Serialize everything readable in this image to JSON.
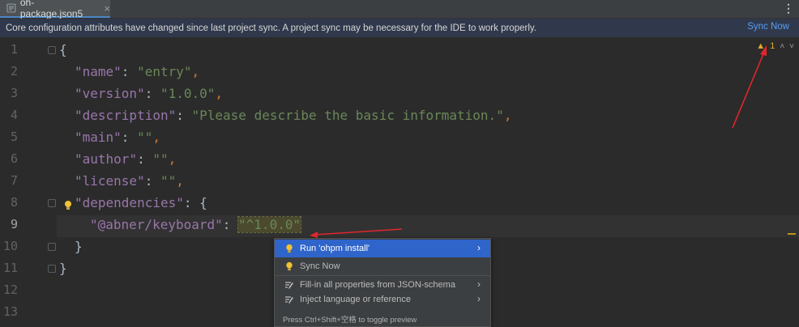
{
  "tab": {
    "filename": "oh-package.json5",
    "close": "×"
  },
  "menu_glyph": "⋮",
  "banner": {
    "message": "Core configuration attributes have changed since last project sync. A project sync may be necessary for the IDE to work properly.",
    "action": "Sync Now"
  },
  "line_numbers": [
    "1",
    "2",
    "3",
    "4",
    "5",
    "6",
    "7",
    "8",
    "9",
    "10",
    "11",
    "12",
    "13"
  ],
  "active_line": "9",
  "code": {
    "l1_brace": "{",
    "l2": {
      "key": "\"name\"",
      "colon": ": ",
      "value": "\"entry\"",
      "comma": ","
    },
    "l3": {
      "key": "\"version\"",
      "colon": ": ",
      "value": "\"1.0.0\"",
      "comma": ","
    },
    "l4": {
      "key": "\"description\"",
      "colon": ": ",
      "value": "\"Please describe the basic information.\"",
      "comma": ","
    },
    "l5": {
      "key": "\"main\"",
      "colon": ": ",
      "value": "\"\"",
      "comma": ","
    },
    "l6": {
      "key": "\"author\"",
      "colon": ": ",
      "value": "\"\"",
      "comma": ","
    },
    "l7": {
      "key": "\"license\"",
      "colon": ": ",
      "value": "\"\"",
      "comma": ","
    },
    "l8": {
      "key": "\"dependencies\"",
      "colon": ": ",
      "brace": "{"
    },
    "l9": {
      "key": "\"@abner/keyboard\"",
      "colon": ": ",
      "value": "\"^1.0.0\""
    },
    "l10_brace": "}",
    "l11_brace": "}"
  },
  "status": {
    "warn_glyph": "▲",
    "count": "1",
    "up": "˄",
    "down": "˅"
  },
  "popup": {
    "items": [
      {
        "label": "Run 'ohpm install'",
        "icon": "bulb-icon",
        "has_submenu": true,
        "selected": true
      },
      {
        "label": "Sync Now",
        "icon": "bulb-icon",
        "has_submenu": false,
        "selected": false
      },
      {
        "label": "Fill-in all properties from JSON-schema",
        "icon": "pencil-icon",
        "has_submenu": true,
        "selected": false
      },
      {
        "label": "Inject language or reference",
        "icon": "pencil-icon",
        "has_submenu": true,
        "selected": false
      }
    ],
    "arrow": "›",
    "footer": "Press Ctrl+Shift+空格 to toggle preview"
  },
  "colors": {
    "accent": "#2f65ca",
    "link": "#589df6",
    "banner_bg": "#30394b",
    "annotation": "#e0262b"
  }
}
